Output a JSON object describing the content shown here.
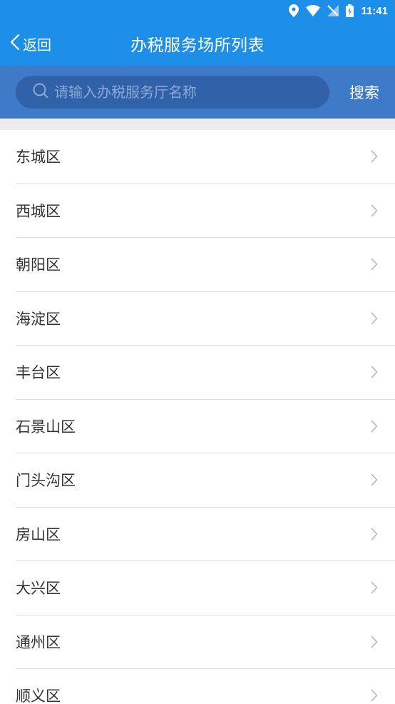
{
  "status_bar": {
    "time": "11:41",
    "icons": [
      "location-icon",
      "wifi-icon",
      "signal-off-icon",
      "battery-icon"
    ]
  },
  "header": {
    "back_label": "返回",
    "title": "办税服务场所列表"
  },
  "search": {
    "placeholder": "请输入办税服务厅名称",
    "button_label": "搜索"
  },
  "colors": {
    "header_blue": "#1e8fe8",
    "search_bar_blue": "#3f7ac9",
    "search_box_blue": "#3162a9"
  },
  "districts": [
    {
      "label": "东城区"
    },
    {
      "label": "西城区"
    },
    {
      "label": "朝阳区"
    },
    {
      "label": "海淀区"
    },
    {
      "label": "丰台区"
    },
    {
      "label": "石景山区"
    },
    {
      "label": "门头沟区"
    },
    {
      "label": "房山区"
    },
    {
      "label": "大兴区"
    },
    {
      "label": "通州区"
    },
    {
      "label": "顺义区"
    }
  ]
}
